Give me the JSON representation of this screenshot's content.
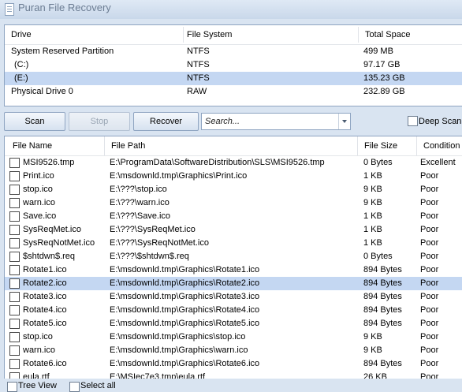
{
  "window": {
    "title": "Puran File Recovery"
  },
  "drives": {
    "columns": [
      "Drive",
      "File System",
      "Total Space"
    ],
    "rows": [
      {
        "drive": "System Reserved Partition",
        "fs": "NTFS",
        "space": "499 MB"
      },
      {
        "drive": "(C:)",
        "fs": "NTFS",
        "space": "97.17 GB"
      },
      {
        "drive": "(E:)",
        "fs": "NTFS",
        "space": "135.23 GB",
        "selected": true
      },
      {
        "drive": "Physical Drive 0",
        "fs": "RAW",
        "space": "232.89 GB"
      }
    ]
  },
  "toolbar": {
    "scan_label": "Scan",
    "stop_label": "Stop",
    "recover_label": "Recover",
    "search_placeholder": "Search...",
    "deep_scan_label": "Deep Scan"
  },
  "files": {
    "columns": [
      "File Name",
      "File Path",
      "File Size",
      "Condition"
    ],
    "rows": [
      {
        "name": "MSI9526.tmp",
        "path": "E:\\ProgramData\\SoftwareDistribution\\SLS\\MSI9526.tmp",
        "size": "0 Bytes",
        "condition": "Excellent"
      },
      {
        "name": "Print.ico",
        "path": "E:\\msdownld.tmp\\Graphics\\Print.ico",
        "size": "1 KB",
        "condition": "Poor"
      },
      {
        "name": "stop.ico",
        "path": "E:\\???\\stop.ico",
        "size": "9 KB",
        "condition": "Poor"
      },
      {
        "name": "warn.ico",
        "path": "E:\\???\\warn.ico",
        "size": "9 KB",
        "condition": "Poor"
      },
      {
        "name": "Save.ico",
        "path": "E:\\???\\Save.ico",
        "size": "1 KB",
        "condition": "Poor"
      },
      {
        "name": "SysReqMet.ico",
        "path": "E:\\???\\SysReqMet.ico",
        "size": "1 KB",
        "condition": "Poor"
      },
      {
        "name": "SysReqNotMet.ico",
        "path": "E:\\???\\SysReqNotMet.ico",
        "size": "1 KB",
        "condition": "Poor"
      },
      {
        "name": "$shtdwn$.req",
        "path": "E:\\???\\$shtdwn$.req",
        "size": "0 Bytes",
        "condition": "Poor"
      },
      {
        "name": "Rotate1.ico",
        "path": "E:\\msdownld.tmp\\Graphics\\Rotate1.ico",
        "size": "894 Bytes",
        "condition": "Poor"
      },
      {
        "name": "Rotate2.ico",
        "path": "E:\\msdownld.tmp\\Graphics\\Rotate2.ico",
        "size": "894 Bytes",
        "condition": "Poor",
        "selected": true
      },
      {
        "name": "Rotate3.ico",
        "path": "E:\\msdownld.tmp\\Graphics\\Rotate3.ico",
        "size": "894 Bytes",
        "condition": "Poor"
      },
      {
        "name": "Rotate4.ico",
        "path": "E:\\msdownld.tmp\\Graphics\\Rotate4.ico",
        "size": "894 Bytes",
        "condition": "Poor"
      },
      {
        "name": "Rotate5.ico",
        "path": "E:\\msdownld.tmp\\Graphics\\Rotate5.ico",
        "size": "894 Bytes",
        "condition": "Poor"
      },
      {
        "name": "stop.ico",
        "path": "E:\\msdownld.tmp\\Graphics\\stop.ico",
        "size": "9 KB",
        "condition": "Poor"
      },
      {
        "name": "warn.ico",
        "path": "E:\\msdownld.tmp\\Graphics\\warn.ico",
        "size": "9 KB",
        "condition": "Poor"
      },
      {
        "name": "Rotate6.ico",
        "path": "E:\\msdownld.tmp\\Graphics\\Rotate6.ico",
        "size": "894 Bytes",
        "condition": "Poor"
      },
      {
        "name": "eula.rtf",
        "path": "E:\\MSIec7e3.tmp\\eula.rtf",
        "size": "26 KB",
        "condition": "Poor"
      }
    ]
  },
  "footer": {
    "tree_view_label": "Tree View",
    "select_all_label": "Select all"
  }
}
